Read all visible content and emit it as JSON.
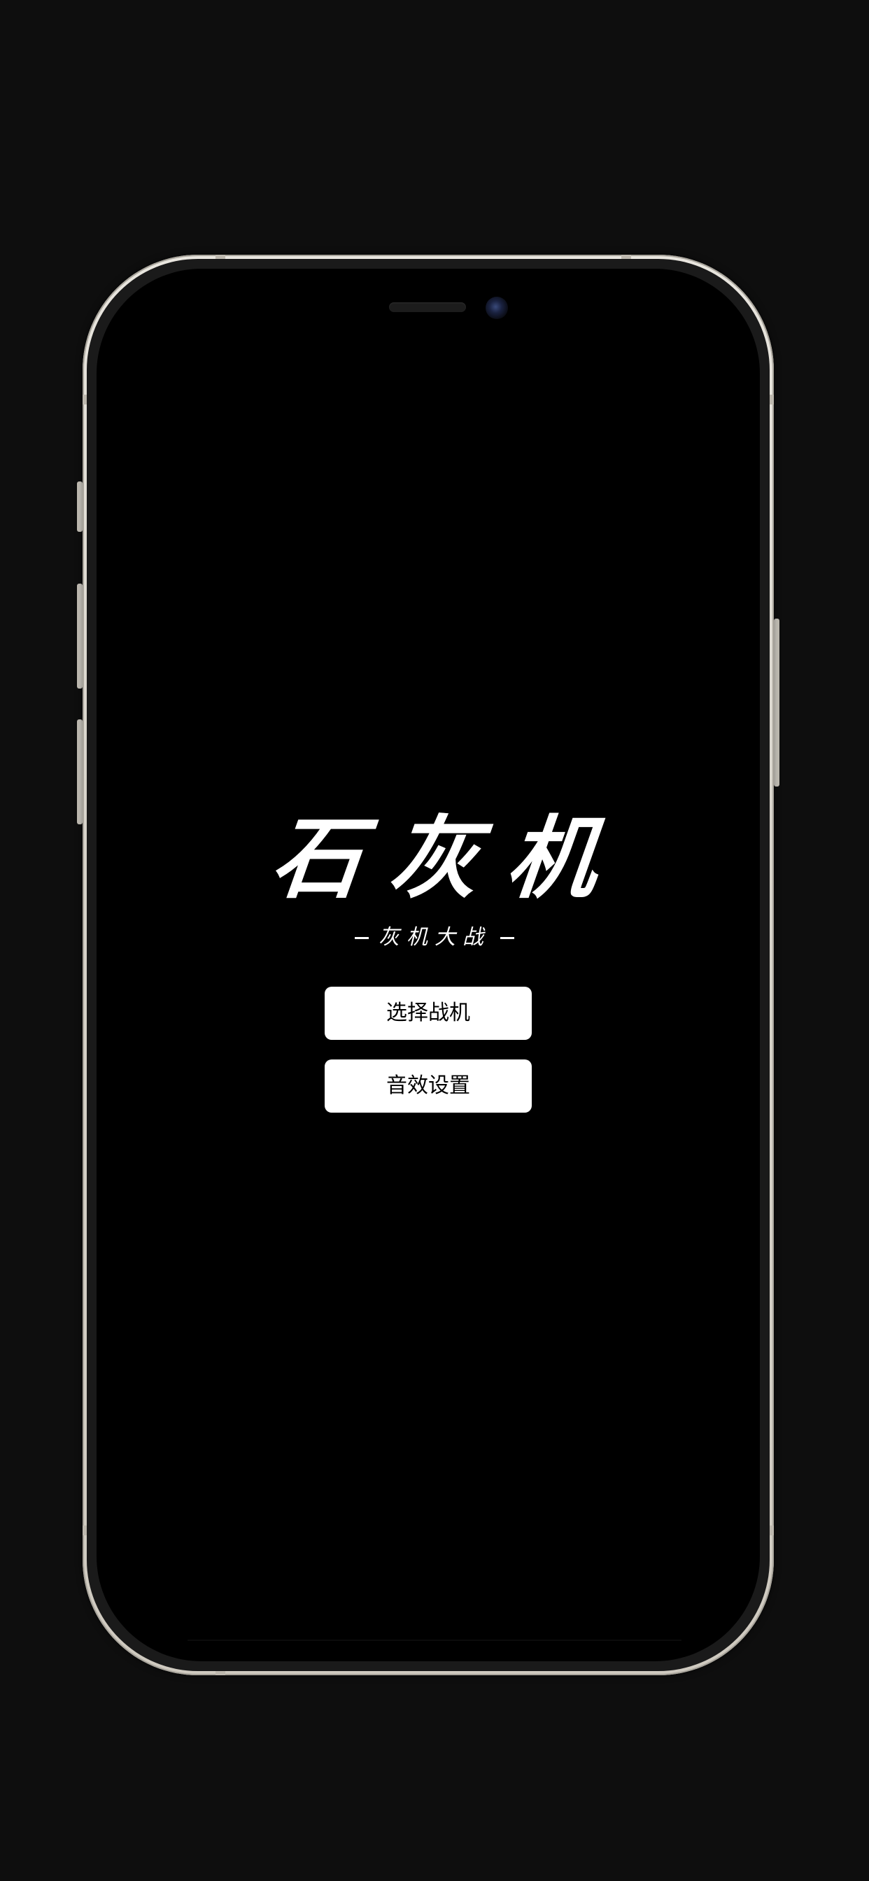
{
  "game": {
    "title": "石灰机",
    "subtitle": "灰机大战"
  },
  "menu": {
    "select_plane_label": "选择战机",
    "sound_settings_label": "音效设置"
  },
  "colors": {
    "background": "#0e0e0e",
    "screen": "#000000",
    "frame": "#e3dfd7",
    "text": "#ffffff",
    "button_bg": "#ffffff",
    "button_text": "#000000"
  }
}
